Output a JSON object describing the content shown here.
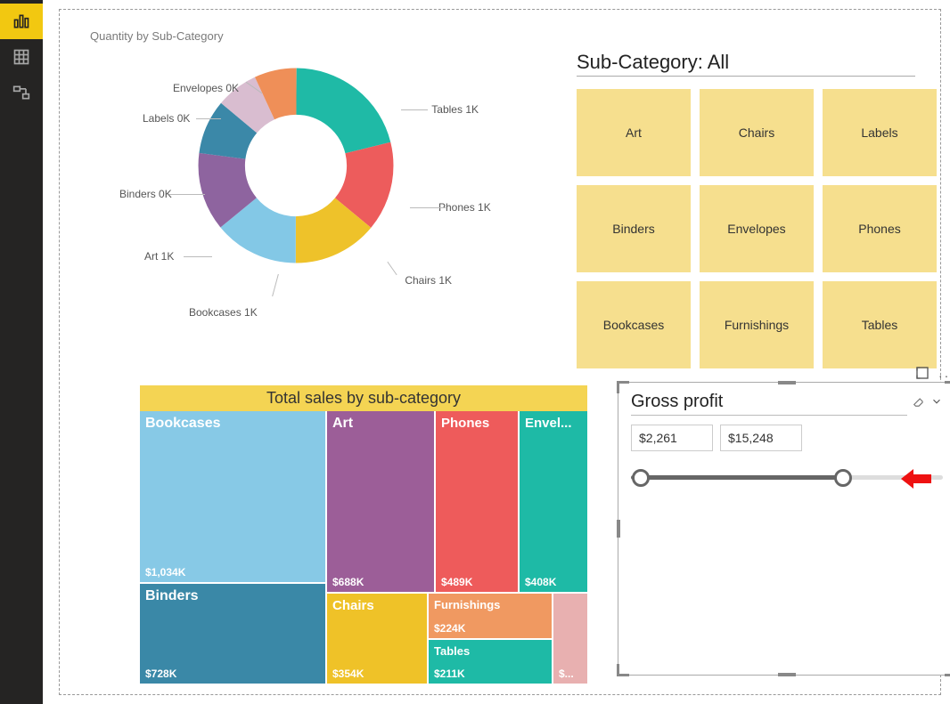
{
  "sidebar": {
    "items": [
      "report-view",
      "data-view",
      "model-view"
    ]
  },
  "donut": {
    "title": "Quantity by Sub-Category",
    "labels": {
      "tables": "Tables 1K",
      "phones": "Phones 1K",
      "chairs": "Chairs 1K",
      "bookcases": "Bookcases 1K",
      "art": "Art 1K",
      "binders": "Binders 0K",
      "labels": "Labels 0K",
      "envelopes": "Envelopes 0K"
    }
  },
  "slicer": {
    "title": "Sub-Category: All",
    "items": [
      "Art",
      "Chairs",
      "Labels",
      "Binders",
      "Envelopes",
      "Phones",
      "Bookcases",
      "Furnishings",
      "Tables"
    ]
  },
  "treemap": {
    "title": "Total sales by sub-category",
    "cells": {
      "bookcases": {
        "label": "Bookcases",
        "value": "$1,034K"
      },
      "binders": {
        "label": "Binders",
        "value": "$728K"
      },
      "art": {
        "label": "Art",
        "value": "$688K"
      },
      "phones": {
        "label": "Phones",
        "value": "$489K"
      },
      "envelopes": {
        "label": "Envel...",
        "value": "$408K"
      },
      "chairs": {
        "label": "Chairs",
        "value": "$354K"
      },
      "furnishings": {
        "label": "Furnishings",
        "value": "$224K"
      },
      "tables": {
        "label": "Tables",
        "value": "$211K"
      },
      "tiny": {
        "label": "",
        "value": "$..."
      }
    }
  },
  "grossprofit": {
    "title": "Gross profit",
    "min": "$2,261",
    "max": "$15,248",
    "slider_pct": 68
  },
  "chart_data": [
    {
      "type": "pie",
      "title": "Quantity by Sub-Category",
      "series": [
        {
          "name": "Quantity",
          "categories": [
            "Tables",
            "Phones",
            "Chairs",
            "Bookcases",
            "Art",
            "Binders",
            "Labels",
            "Envelopes"
          ],
          "values": [
            1000,
            1000,
            1000,
            1000,
            1000,
            400,
            300,
            300
          ],
          "display": [
            "1K",
            "1K",
            "1K",
            "1K",
            "1K",
            "0K",
            "0K",
            "0K"
          ]
        }
      ]
    },
    {
      "type": "bar",
      "title": "Total sales by sub-category",
      "categories": [
        "Bookcases",
        "Binders",
        "Art",
        "Phones",
        "Envelopes",
        "Chairs",
        "Furnishings",
        "Tables"
      ],
      "values": [
        1034,
        728,
        688,
        489,
        408,
        354,
        224,
        211
      ],
      "unit": "$K"
    }
  ]
}
